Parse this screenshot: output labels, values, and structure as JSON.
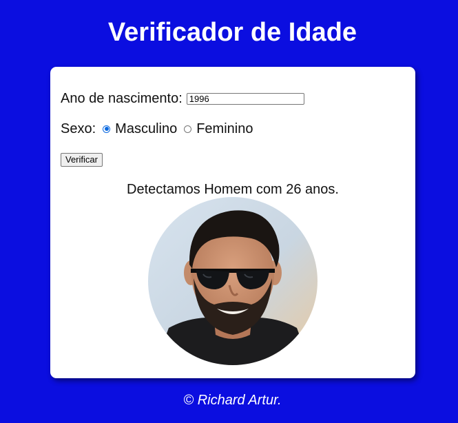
{
  "page": {
    "title": "Verificador de Idade",
    "footer": "© Richard Artur."
  },
  "form": {
    "year_label": "Ano de nascimento:",
    "year_value": "1996",
    "sex_label": "Sexo:",
    "options": [
      "Masculino",
      "Feminino"
    ],
    "selected": "Masculino",
    "button_label": "Verificar"
  },
  "result": {
    "text": "Detectamos Homem com 26 anos.",
    "image": "man-photo"
  },
  "colors": {
    "background": "#0b0ee0",
    "card": "#ffffff",
    "radio_accent": "#0a69e0"
  }
}
